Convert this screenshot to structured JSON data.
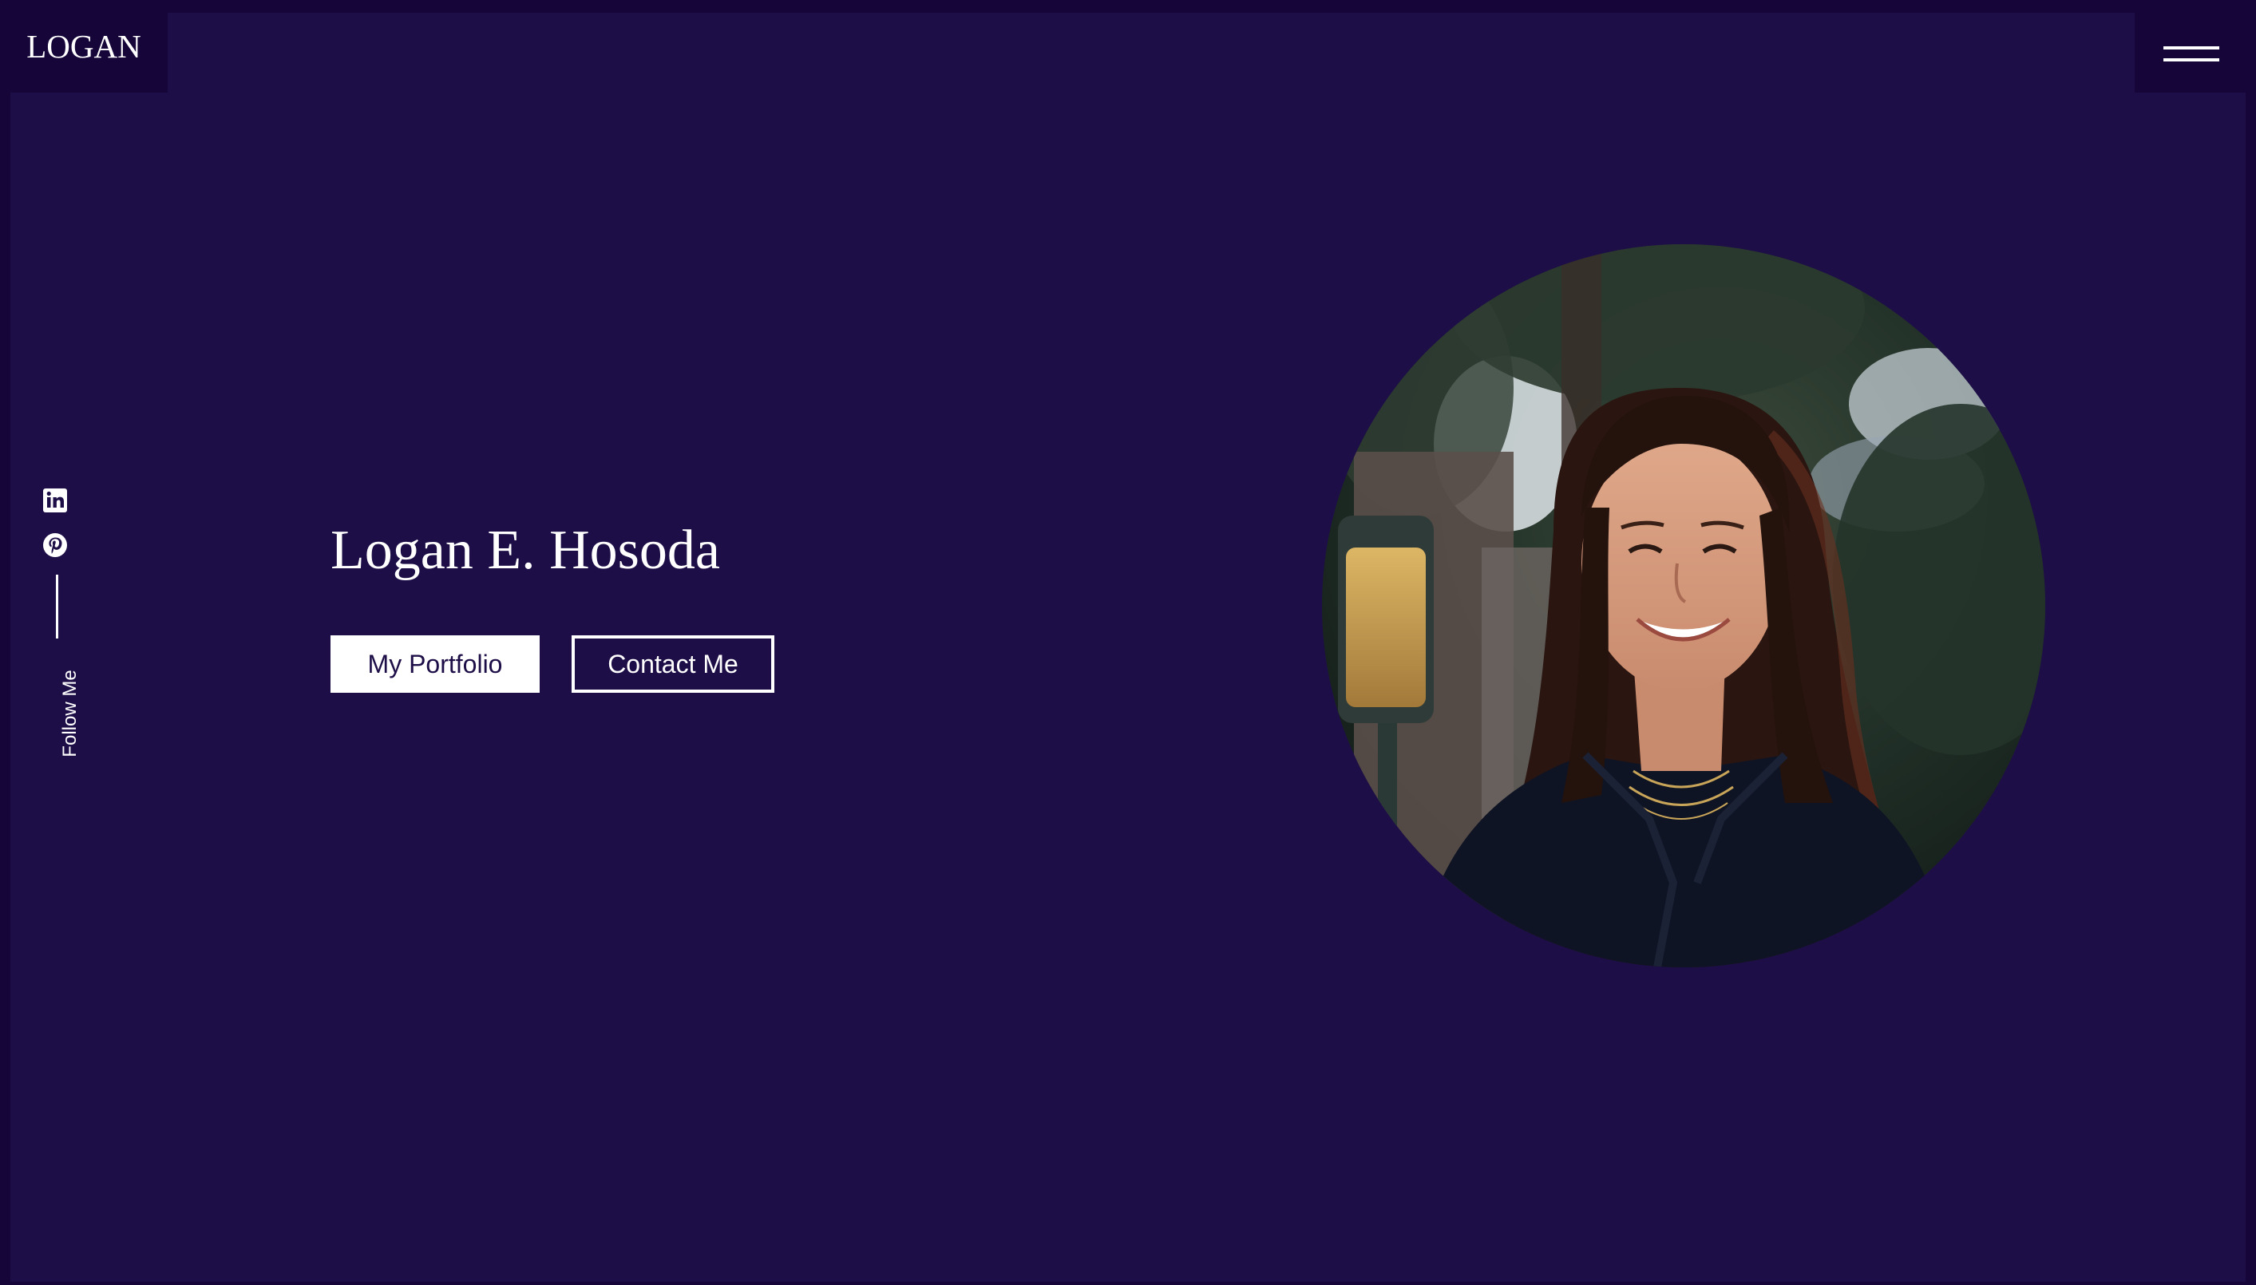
{
  "header": {
    "logo_text": "LOGAN",
    "menu_icon": "hamburger-menu-icon"
  },
  "social": {
    "links": [
      {
        "icon": "linkedin-icon"
      },
      {
        "icon": "pinterest-icon"
      }
    ],
    "follow_label": "Follow Me"
  },
  "hero": {
    "name": "Logan E. Hosoda",
    "portfolio_button": "My Portfolio",
    "contact_button": "Contact Me"
  },
  "colors": {
    "background": "#1d0e47",
    "frame": "#150539",
    "text": "#ffffff"
  }
}
